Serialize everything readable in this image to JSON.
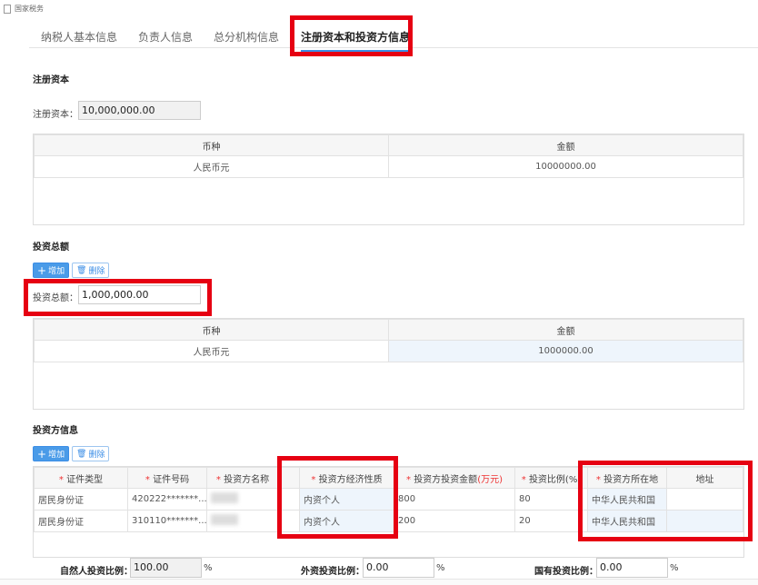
{
  "window": {
    "title": "国家税务"
  },
  "tabs": [
    "纳税人基本信息",
    "负责人信息",
    "总分机构信息",
    "注册资本和投资方信息"
  ],
  "registered_capital": {
    "heading": "注册资本",
    "label": "注册资本：",
    "value": "10,000,000.00",
    "columns": [
      "币种",
      "金额"
    ],
    "rows": [
      [
        "人民币元",
        "10000000.00"
      ]
    ]
  },
  "investment_total": {
    "heading": "投资总额",
    "add": "增加",
    "delete": "删除",
    "label": "投资总额：",
    "value": "1,000,000.00",
    "columns": [
      "币种",
      "金额"
    ],
    "rows": [
      [
        "人民币元",
        "1000000.00"
      ]
    ]
  },
  "investors": {
    "heading": "投资方信息",
    "add": "增加",
    "delete": "删除",
    "columns": {
      "id_type": "证件类型",
      "id_no": "证件号码",
      "name": "投资方名称",
      "nature": "投资方经济性质",
      "amount": "投资方投资金额",
      "amount_unit": "(万元)",
      "ratio": "投资比例(%)",
      "location": "投资方所在地",
      "address": "地址"
    },
    "rows": [
      {
        "id_type": "居民身份证",
        "id_no": "420222*******...",
        "nature": "内资个人",
        "amount": "800",
        "ratio": "80",
        "location": "中华人民共和国",
        "address": ""
      },
      {
        "id_type": "居民身份证",
        "id_no": "310110*******...",
        "nature": "内资个人",
        "amount": "200",
        "ratio": "20",
        "location": "中华人民共和国",
        "address": ""
      }
    ]
  },
  "ratios": {
    "natural_label": "自然人投资比例：",
    "natural": "100.00",
    "foreign_label": "外资投资比例：",
    "foreign": "0.00",
    "state_label": "国有投资比例：",
    "state": "0.00",
    "unit": "%"
  }
}
